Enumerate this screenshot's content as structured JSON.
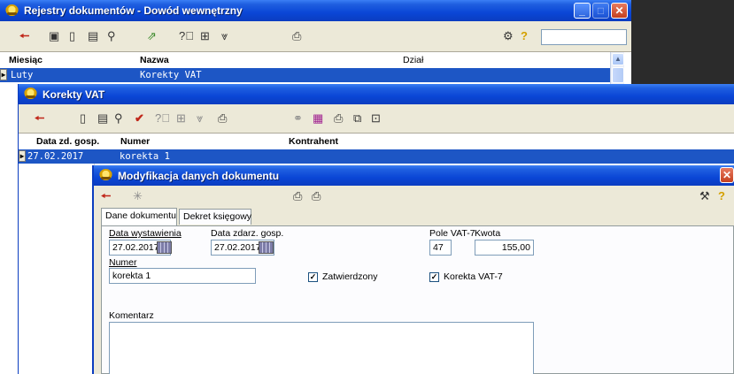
{
  "window1": {
    "title": "Rejestry dokumentów - Dowód wewnętrzny",
    "columns": [
      "Miesiąc",
      "Nazwa",
      "Dział"
    ],
    "row": {
      "month": "Luty",
      "name": "Korekty VAT"
    },
    "search_value": ""
  },
  "window2": {
    "title": "Korekty VAT",
    "columns": [
      "Data zd. gosp.",
      "Numer",
      "Kontrahent"
    ],
    "row": {
      "date": "27.02.2017",
      "number": "korekta 1"
    }
  },
  "dialog": {
    "title": "Modyfikacja danych dokumentu",
    "tabs": [
      "Dane dokumentu",
      "Dekret księgowy"
    ],
    "fields": {
      "issue_date_label": "Data wystawienia",
      "issue_date": "27.02.2017",
      "event_date_label": "Data zdarz. gosp.",
      "event_date": "27.02.2017",
      "vat_field_label": "Pole VAT-7",
      "vat_field": "47",
      "amount_label": "Kwota",
      "amount": "155,00",
      "number_label": "Numer",
      "number": "korekta 1",
      "approved_label": "Zatwierdzony",
      "approved": true,
      "correction_label": "Korekta VAT-7",
      "correction": true,
      "comment_label": "Komentarz",
      "comment": ""
    }
  },
  "icons": {
    "back": "←",
    "help": "?",
    "check": "✔",
    "checkmark": "✓"
  }
}
